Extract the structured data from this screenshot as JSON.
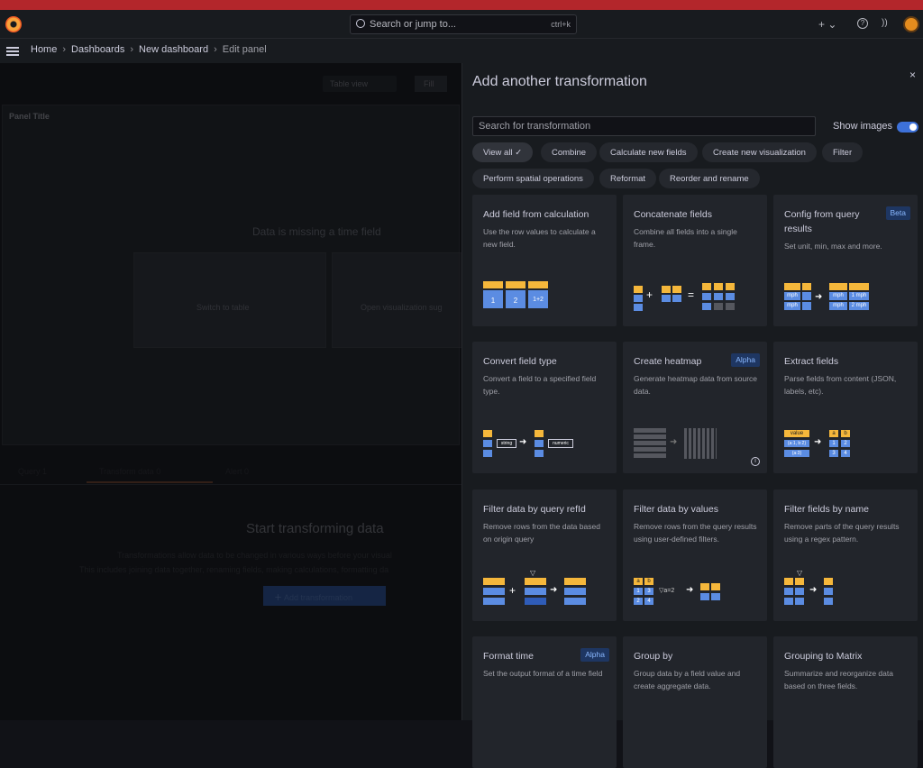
{
  "topbar": {
    "search_placeholder": "Search or jump to...",
    "search_shortcut": "ctrl+k",
    "new_label": "+ ⌄",
    "help_icon": "help-icon",
    "news_icon": "rss-icon"
  },
  "breadcrumb": [
    "Home",
    "Dashboards",
    "New dashboard",
    "Edit panel"
  ],
  "background": {
    "table_view": "Table view",
    "fill": "Fill",
    "panel_title": "Panel Title",
    "missing": "Data is missing a time field",
    "switch_table": "Switch to table",
    "open_viz": "Open visualization sug",
    "tabs": [
      "Query",
      "1",
      "Transform data",
      "0",
      "Alert",
      "0"
    ],
    "start_title": "Start transforming data",
    "desc1": "Transformations allow data to be changed in various ways before your visual",
    "desc2": "This includes joining data together, renaming fields, making calculations, formatting da",
    "add_button": "Add transformation"
  },
  "drawer": {
    "title": "Add another transformation",
    "close": "×",
    "search_placeholder": "Search for transformation",
    "show_images": "Show images",
    "show_images_on": true,
    "chips": [
      "View all ✓",
      "Combine",
      "Calculate new fields",
      "Create new visualization",
      "Filter",
      "Perform spatial operations",
      "Reformat",
      "Reorder and rename"
    ],
    "cards": [
      {
        "title": "Add field from calculation",
        "desc": "Use the row values to calculate a new field.",
        "badge": ""
      },
      {
        "title": "Concatenate fields",
        "desc": "Combine all fields into a single frame.",
        "badge": ""
      },
      {
        "title": "Config from query results",
        "desc": "Set unit, min, max and more.",
        "badge": "Beta"
      },
      {
        "title": "Convert field type",
        "desc": "Convert a field to a specified field type.",
        "badge": ""
      },
      {
        "title": "Create heatmap",
        "desc": "Generate heatmap data from source data.",
        "badge": "Alpha"
      },
      {
        "title": "Extract fields",
        "desc": "Parse fields from content (JSON, labels, etc).",
        "badge": ""
      },
      {
        "title": "Filter data by query refId",
        "desc": "Remove rows from the data based on origin query",
        "badge": ""
      },
      {
        "title": "Filter data by values",
        "desc": "Remove rows from the query results using user-defined filters.",
        "badge": ""
      },
      {
        "title": "Filter fields by name",
        "desc": "Remove parts of the query results using a regex pattern.",
        "badge": ""
      },
      {
        "title": "Format time",
        "desc": "Set the output format of a time field",
        "badge": "Alpha"
      },
      {
        "title": "Group by",
        "desc": "Group data by a field value and create aggregate data.",
        "badge": ""
      },
      {
        "title": "Grouping to Matrix",
        "desc": "Summarize and reorganize data based on three fields.",
        "badge": ""
      }
    ],
    "illustration_labels": {
      "calc": [
        "1",
        "2",
        "1+2"
      ],
      "convert": [
        "string",
        "numeric"
      ],
      "extract": [
        "value",
        "{a:1, b:2}",
        "{a:3}",
        "a",
        "b",
        "1",
        "2",
        "3",
        "4"
      ],
      "values": [
        "a",
        "b",
        "1",
        "3",
        "2",
        "4",
        "a=2"
      ],
      "config": [
        "mph",
        "1 mph",
        "2 mph"
      ]
    }
  }
}
